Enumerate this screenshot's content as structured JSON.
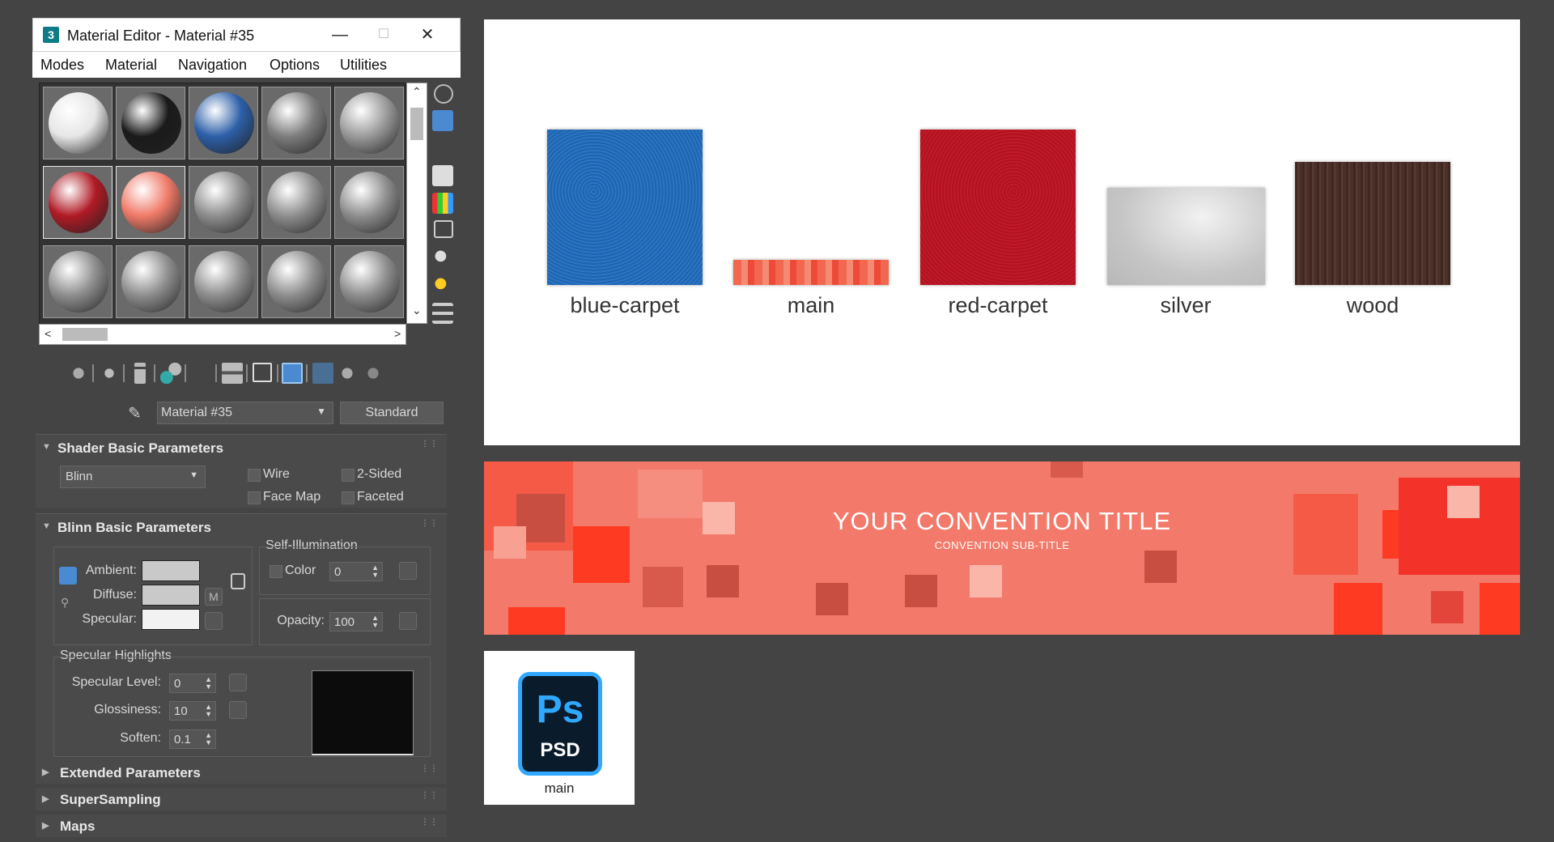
{
  "window": {
    "title": "Material Editor - Material #35",
    "app_icon": "3",
    "controls": {
      "minimize": "—",
      "maximize": "☐",
      "close": "✕"
    }
  },
  "menu": [
    "Modes",
    "Material",
    "Navigation",
    "Options",
    "Utilities"
  ],
  "slots": [
    {
      "color": "#e6e6e6"
    },
    {
      "color": "#1a1a1a"
    },
    {
      "color": "#2c5fa8"
    },
    {
      "color": "#7d7d7d"
    },
    {
      "color": "#9a9a9a"
    },
    {
      "color": "#b01a25"
    },
    {
      "color": "#f07a68"
    },
    {
      "color": "#8e8e8e"
    },
    {
      "color": "#8e8e8e"
    },
    {
      "color": "#8e8e8e"
    },
    {
      "color": "#8e8e8e"
    },
    {
      "color": "#8e8e8e"
    },
    {
      "color": "#8e8e8e"
    },
    {
      "color": "#8e8e8e"
    },
    {
      "color": "#8e8e8e"
    }
  ],
  "scroll": {
    "up": "⌃",
    "down": "⌄",
    "left": "<",
    "right": ">"
  },
  "material": {
    "name": "Material #35",
    "type": "Standard"
  },
  "shader_basic": {
    "header": "Shader Basic Parameters",
    "shader": "Blinn",
    "wire": "Wire",
    "two_sided": "2-Sided",
    "face_map": "Face Map",
    "faceted": "Faceted"
  },
  "blinn_basic": {
    "header": "Blinn Basic Parameters",
    "self_illum_label": "Self-Illumination",
    "ambient": "Ambient:",
    "diffuse": "Diffuse:",
    "specular": "Specular:",
    "m_button": "M",
    "color_label": "Color",
    "color_value": "0",
    "opacity_label": "Opacity:",
    "opacity_value": "100",
    "spec_header": "Specular Highlights",
    "spec_level_label": "Specular Level:",
    "spec_level": "0",
    "gloss_label": "Glossiness:",
    "gloss": "10",
    "soften_label": "Soften:",
    "soften": "0.1"
  },
  "collapsed_rollouts": [
    "Extended Parameters",
    "SuperSampling",
    "Maps"
  ],
  "textures": [
    {
      "label": "blue-carpet",
      "color": "#1f63ad"
    },
    {
      "label": "main",
      "color": "#f2674f"
    },
    {
      "label": "red-carpet",
      "color": "#c11a2a"
    },
    {
      "label": "silver",
      "color": "#cfcfcf"
    },
    {
      "label": "wood",
      "color": "#4a3029"
    }
  ],
  "banner": {
    "title": "YOUR CONVENTION TITLE",
    "subtitle": "CONVENTION SUB-TITLE"
  },
  "file": {
    "name": "main",
    "icon_text": "Ps",
    "format": "PSD"
  }
}
